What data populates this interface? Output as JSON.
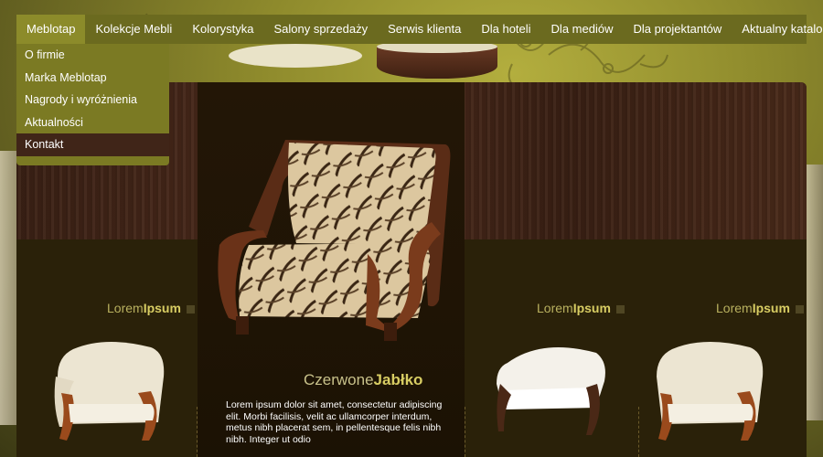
{
  "nav": {
    "items": [
      {
        "label": "Meblotap",
        "active": true
      },
      {
        "label": "Kolekcje Mebli"
      },
      {
        "label": "Kolorystyka"
      },
      {
        "label": "Salony sprzedaży"
      },
      {
        "label": "Serwis klienta"
      },
      {
        "label": "Dla hoteli"
      },
      {
        "label": "Dla mediów"
      },
      {
        "label": "Dla projektantów"
      },
      {
        "label": "Aktualny katalog"
      }
    ]
  },
  "dropdown": {
    "items": [
      {
        "label": "O firmie"
      },
      {
        "label": "Marka Meblotap"
      },
      {
        "label": "Nagrody i wyróżnienia"
      },
      {
        "label": "Aktualności"
      },
      {
        "label": "Kontakt",
        "selected": true
      }
    ]
  },
  "products": [
    {
      "title_a": "Lorem",
      "title_b": "Ipsum"
    },
    {
      "title_a": "Lorem",
      "title_b": "Ipsum"
    },
    {
      "title_a": "Lorem",
      "title_b": "Ipsum"
    }
  ],
  "featured": {
    "title_a": "Czerwone",
    "title_b": "Jabłko",
    "description": "Lorem ipsum dolor sit amet, consectetur adipiscing elit. Morbi facilisis, velit ac ullamcorper interdum, metus nibh placerat sem, in pellentesque felis nibh  nibh. Integer ut odio"
  },
  "colors": {
    "nav_bg": "#6b6a1f",
    "nav_active": "#8c8b2a",
    "dropdown_bg": "#7b7a23",
    "dropdown_selected": "#402518",
    "accent_text": "#d8cd63"
  },
  "icons": [
    "square-bullet-icon"
  ]
}
